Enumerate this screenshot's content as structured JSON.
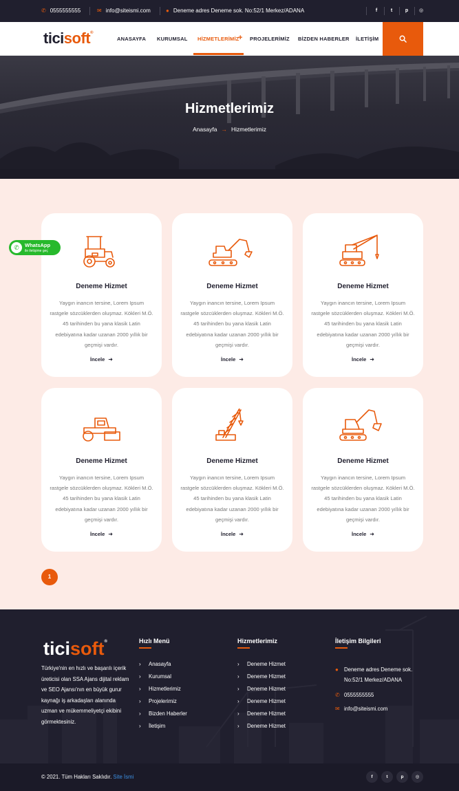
{
  "topbar": {
    "phone": "0555555555",
    "email": "info@siteismi.com",
    "address": "Deneme adres Deneme sok. No:52/1 Merkez/ADANA",
    "social": [
      "facebook-icon",
      "twitter-icon",
      "pinterest-icon",
      "instagram-icon"
    ]
  },
  "logo": {
    "part1": "tici",
    "part2": "soft",
    "mark": "®"
  },
  "nav": {
    "items": [
      "ANASAYFA",
      "KURUMSAL",
      "HİZMETLERİMİZ",
      "PROJELERİMİZ",
      "BİZDEN HABERLER",
      "İLETİŞİM"
    ],
    "active_index": 2,
    "plus": "+"
  },
  "hero": {
    "title": "Hizmetlerimiz",
    "breadcrumb_home": "Anasayfa",
    "breadcrumb_sep": "→",
    "breadcrumb_current": "Hizmetlerimiz"
  },
  "services": {
    "cards": [
      {
        "title": "Deneme Hizmet",
        "icon": "tractor-icon",
        "desc": "Yaygın inancın tersine, Lorem Ipsum rastgele sözcüklerden oluşmaz. Kökleri M.Ö. 45 tarihinden bu yana klasik Latin edebiyatına kadar uzanan 2000 yıllık bir geçmişi vardır.",
        "more": "İncele"
      },
      {
        "title": "Deneme Hizmet",
        "icon": "excavator-icon",
        "desc": "Yaygın inancın tersine, Lorem Ipsum rastgele sözcüklerden oluşmaz. Kökleri M.Ö. 45 tarihinden bu yana klasik Latin edebiyatına kadar uzanan 2000 yıllık bir geçmişi vardır.",
        "more": "İncele"
      },
      {
        "title": "Deneme Hizmet",
        "icon": "crane-truck-icon",
        "desc": "Yaygın inancın tersine, Lorem Ipsum rastgele sözcüklerden oluşmaz. Kökleri M.Ö. 45 tarihinden bu yana klasik Latin edebiyatına kadar uzanan 2000 yıllık bir geçmişi vardır.",
        "more": "İncele"
      },
      {
        "title": "Deneme Hizmet",
        "icon": "road-roller-icon",
        "desc": "Yaygın inancın tersine, Lorem Ipsum rastgele sözcüklerden oluşmaz. Kökleri M.Ö. 45 tarihinden bu yana klasik Latin edebiyatına kadar uzanan 2000 yıllık bir geçmişi vardır.",
        "more": "İncele"
      },
      {
        "title": "Deneme Hizmet",
        "icon": "tower-crane-icon",
        "desc": "Yaygın inancın tersine, Lorem Ipsum rastgele sözcüklerden oluşmaz. Kökleri M.Ö. 45 tarihinden bu yana klasik Latin edebiyatına kadar uzanan 2000 yıllık bir geçmişi vardır.",
        "more": "İncele"
      },
      {
        "title": "Deneme Hizmet",
        "icon": "digger-icon",
        "desc": "Yaygın inancın tersine, Lorem Ipsum rastgele sözcüklerden oluşmaz. Kökleri M.Ö. 45 tarihinden bu yana klasik Latin edebiyatına kadar uzanan 2000 yıllık bir geçmişi vardır.",
        "more": "İncele"
      }
    ],
    "page": "1"
  },
  "whatsapp": {
    "label": "WhatsApp",
    "sub": "ile iletişime geç"
  },
  "footer": {
    "logo": {
      "part1": "tici",
      "part2": "soft",
      "mark": "®"
    },
    "description": "Türkiye'nin en hızlı ve başarılı içerik üreticisi olan SSA Ajans dijital reklam ve SEO Ajansı'nın en büyük gurur kaynağı iş arkadaşları alanında uzman ve mükemmeliyetçi ekibini görmektesiniz.",
    "menu_title": "Hızlı Menü",
    "menu_items": [
      "Anasayfa",
      "Kurumsal",
      "Hizmetlerimiz",
      "Projelerimiz",
      "Bizden Haberler",
      "İletişim"
    ],
    "services_title": "Hizmetlerimiz",
    "service_items": [
      "Deneme Hizmet",
      "Deneme Hizmet",
      "Deneme Hizmet",
      "Deneme Hizmet",
      "Deneme Hizmet",
      "Deneme Hizmet"
    ],
    "contact_title": "İletişim Bilgileri",
    "address": "Deneme adres Deneme sok. No:52/1 Merkez/ADANA",
    "phone": "0555555555",
    "email": "info@siteismi.com"
  },
  "bottombar": {
    "copyright": "© 2021. Tüm Hakları Saklıdır.",
    "site_link": "Site İsmi"
  },
  "colors": {
    "accent": "#e85a0c",
    "dark": "#201f2e",
    "services_bg": "#fdebe6"
  }
}
